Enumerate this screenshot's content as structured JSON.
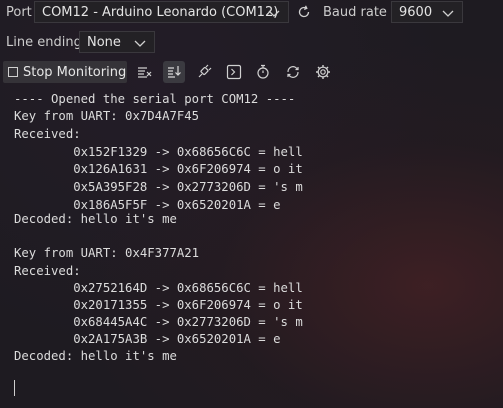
{
  "toolbar": {
    "port_label": "Port",
    "port_value": "COM12 - Arduino Leonardo (COM12)",
    "baud_label": "Baud rate",
    "baud_value": "9600",
    "line_ending_label": "Line ending",
    "line_ending_value": "None",
    "stop_label": "Stop Monitoring"
  },
  "icons": {
    "refresh": "refresh-icon",
    "clear": "clear-output-icon",
    "autoscroll": "toggle-autoscroll-icon",
    "connect": "plug-icon",
    "terminal": "terminal-icon",
    "timestamp": "stopwatch-icon",
    "reset": "reset-icon",
    "settings": "gear-icon"
  },
  "console": {
    "lines": [
      "---- Opened the serial port COM12 ----",
      "Key from UART: 0x7D4A7F45",
      "Received:",
      "        0x152F1329 -> 0x68656C6C = hell",
      "        0x126A1631 -> 0x6F206974 = o it",
      "        0x5A395F28 -> 0x2773206D = 's m",
      "        0x186A5F5F -> 0x6520201A = e",
      "Decoded: hello it's me",
      "",
      "Key from UART: 0x4F377A21",
      "Received:",
      "        0x2752164D -> 0x68656C6C = hell",
      "        0x20171355 -> 0x6F206974 = o it",
      "        0x68445A4C -> 0x2773206D = 's m",
      "        0x2A175A3B -> 0x6520201A = e",
      "Decoded: hello it's me"
    ]
  }
}
